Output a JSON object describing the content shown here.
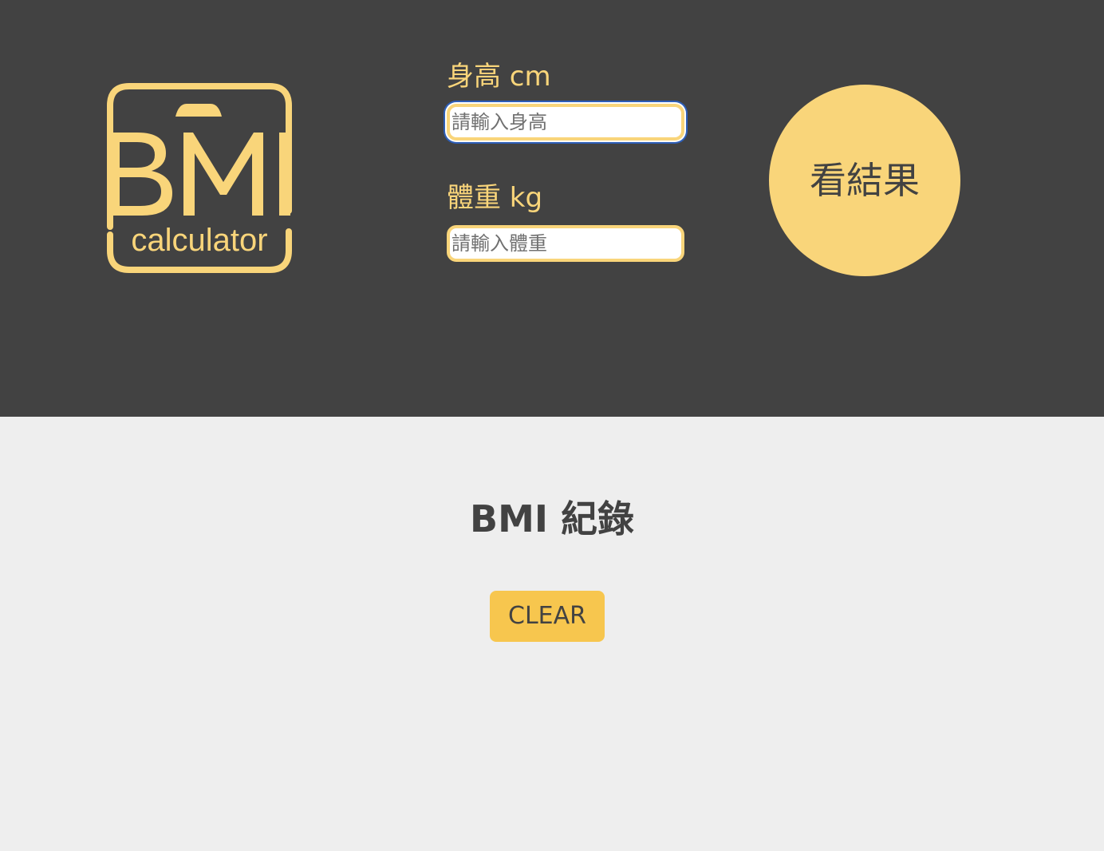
{
  "logo": {
    "text_main": "BMI",
    "text_sub": "calculator",
    "color": "#F9D57A"
  },
  "form": {
    "height": {
      "label": "身高 cm",
      "placeholder": "請輸入身高",
      "value": ""
    },
    "weight": {
      "label": "體重 kg",
      "placeholder": "請輸入體重",
      "value": ""
    },
    "submit_label": "看結果"
  },
  "records": {
    "title": "BMI 紀錄",
    "clear_label": "CLEAR"
  },
  "colors": {
    "header_bg": "#424242",
    "accent": "#F9D57A",
    "page_bg": "#EEEEEE",
    "clear_bg": "#F7C64E",
    "focus_ring": "#2D5EB8"
  }
}
